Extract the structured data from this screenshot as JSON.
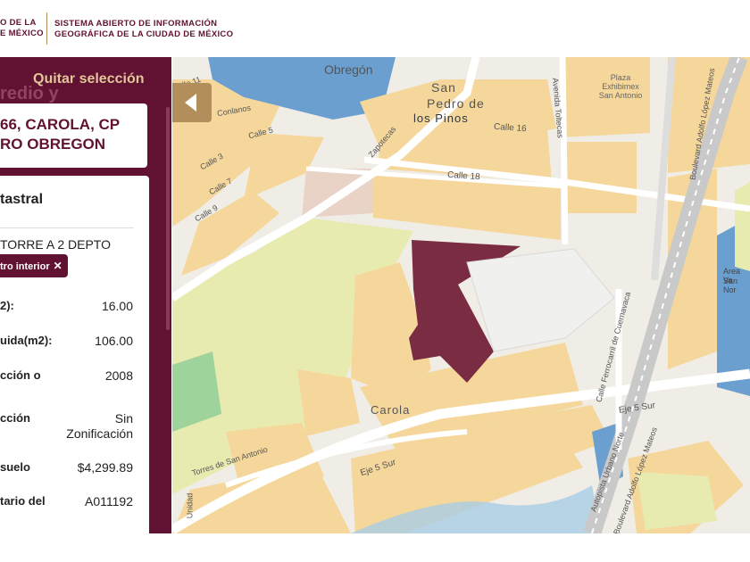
{
  "header": {
    "logo_line1": "O DE LA",
    "logo_line2": "E MÉXICO",
    "system_line1": "SISTEMA ABIERTO DE INFORMACIÓN",
    "system_line2": "GEOGRÁFICA DE LA CIUDAD DE MÉXICO"
  },
  "sidebar": {
    "clear_selection": "Quitar selección",
    "ghost_heading": "redio y",
    "address_line1": "66, CAROLA, CP",
    "address_line2": "RO OBREGON",
    "info_title": "tastral",
    "use_text": "TORRE A 2 DEPTO",
    "filter_tag": "tro interior",
    "filter_close": "✕",
    "rows": [
      {
        "label": "2):",
        "value": "16.00"
      },
      {
        "label": "uida(m2):",
        "value": "106.00"
      },
      {
        "label": "cción o",
        "value": "2008"
      },
      {
        "label": "cción",
        "value": "Sin Zonificación"
      },
      {
        "label": "suelo",
        "value": "$4,299.89"
      },
      {
        "label": "tario del",
        "value": "A011192"
      }
    ]
  },
  "map": {
    "labels": {
      "obregon": "Obregón",
      "san_pedro_1": "San",
      "san_pedro_2": "Pedro de",
      "san_pedro_3": "los Pinos",
      "plaza_1": "Plaza",
      "plaza_2": "Exhibimex",
      "plaza_3": "San Antonio",
      "carola": "Carola",
      "calle16": "Calle 16",
      "calle18": "Calle 18",
      "calle5": "Calle 5",
      "calle3": "Calle 3",
      "calle7": "Calle 7",
      "calle9": "Calle 9",
      "calle11": "Calle 11",
      "zapotecas": "Zapotecas",
      "av_toltecas": "Avenida Toltecas",
      "blvd": "Boulevard Adolfo López Mateos",
      "ferrocarril": "Calle Ferrocarril de Cuernavaca",
      "eje5a": "Eje 5 Sur",
      "eje5b": "Eje 5 Sur",
      "torres": "Torres de San Antonio",
      "autopista": "Autopista Urbano Norte",
      "autopista2": "Boulevard Adolfo López Mateos",
      "area_verde": "Area Ve",
      "san_nor": "San Nor",
      "unidad": "Unidad",
      "conlanos": "Conlanos"
    },
    "colors": {
      "background": "#f0ede6",
      "residential": "#f5d79b",
      "commercial_blue": "#6b9fcf",
      "green_area": "#e8ebb0",
      "park": "#9ed39b",
      "selected_parcel": "#7a2c43",
      "road": "#ffffff",
      "highway": "#c9c9c9",
      "water": "#a9cde6"
    }
  }
}
